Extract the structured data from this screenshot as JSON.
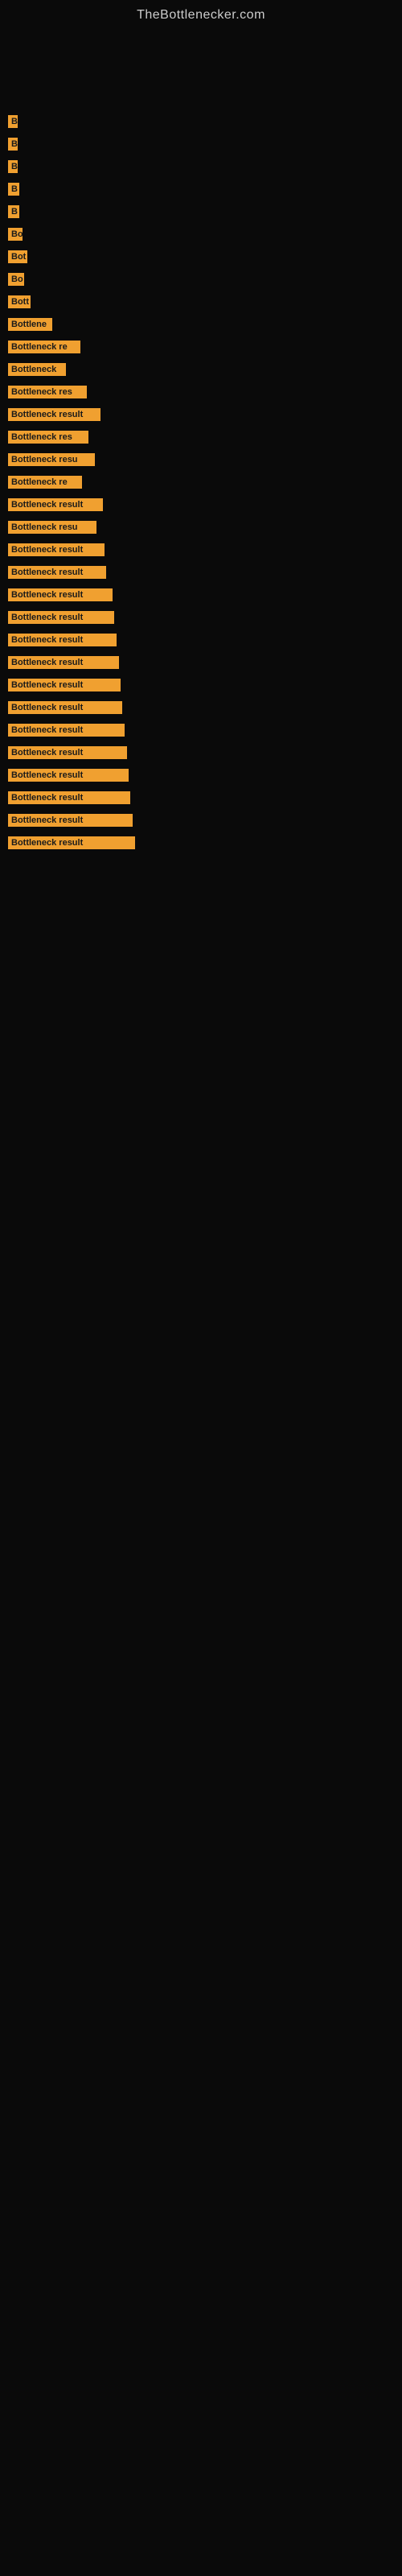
{
  "site": {
    "title": "TheBottlenecker.com"
  },
  "bars": [
    {
      "label": "",
      "width": 8,
      "visible": false
    },
    {
      "label": "",
      "width": 8,
      "visible": false
    },
    {
      "label": "",
      "width": 8,
      "visible": false
    },
    {
      "label": "B",
      "width": 12,
      "visible": true
    },
    {
      "label": "B",
      "width": 12,
      "visible": true
    },
    {
      "label": "B",
      "width": 12,
      "visible": true
    },
    {
      "label": "B",
      "width": 14,
      "visible": true
    },
    {
      "label": "B",
      "width": 14,
      "visible": true
    },
    {
      "label": "Bo",
      "width": 18,
      "visible": true
    },
    {
      "label": "Bot",
      "width": 24,
      "visible": true
    },
    {
      "label": "Bo",
      "width": 20,
      "visible": true
    },
    {
      "label": "Bott",
      "width": 28,
      "visible": true
    },
    {
      "label": "Bottlene",
      "width": 55,
      "visible": true
    },
    {
      "label": "Bottleneck re",
      "width": 90,
      "visible": true
    },
    {
      "label": "Bottleneck",
      "width": 72,
      "visible": true
    },
    {
      "label": "Bottleneck res",
      "width": 98,
      "visible": true
    },
    {
      "label": "Bottleneck result",
      "width": 115,
      "visible": true
    },
    {
      "label": "Bottleneck res",
      "width": 100,
      "visible": true
    },
    {
      "label": "Bottleneck resu",
      "width": 108,
      "visible": true
    },
    {
      "label": "Bottleneck re",
      "width": 92,
      "visible": true
    },
    {
      "label": "Bottleneck result",
      "width": 118,
      "visible": true
    },
    {
      "label": "Bottleneck resu",
      "width": 110,
      "visible": true
    },
    {
      "label": "Bottleneck result",
      "width": 120,
      "visible": true
    },
    {
      "label": "Bottleneck result",
      "width": 122,
      "visible": true
    },
    {
      "label": "Bottleneck result",
      "width": 130,
      "visible": true
    },
    {
      "label": "Bottleneck result",
      "width": 132,
      "visible": true
    },
    {
      "label": "Bottleneck result",
      "width": 135,
      "visible": true
    },
    {
      "label": "Bottleneck result",
      "width": 138,
      "visible": true
    },
    {
      "label": "Bottleneck result",
      "width": 140,
      "visible": true
    },
    {
      "label": "Bottleneck result",
      "width": 142,
      "visible": true
    },
    {
      "label": "Bottleneck result",
      "width": 145,
      "visible": true
    },
    {
      "label": "Bottleneck result",
      "width": 148,
      "visible": true
    },
    {
      "label": "Bottleneck result",
      "width": 150,
      "visible": true
    },
    {
      "label": "Bottleneck result",
      "width": 152,
      "visible": true
    },
    {
      "label": "Bottleneck result",
      "width": 155,
      "visible": true
    },
    {
      "label": "Bottleneck result",
      "width": 158,
      "visible": true
    }
  ]
}
